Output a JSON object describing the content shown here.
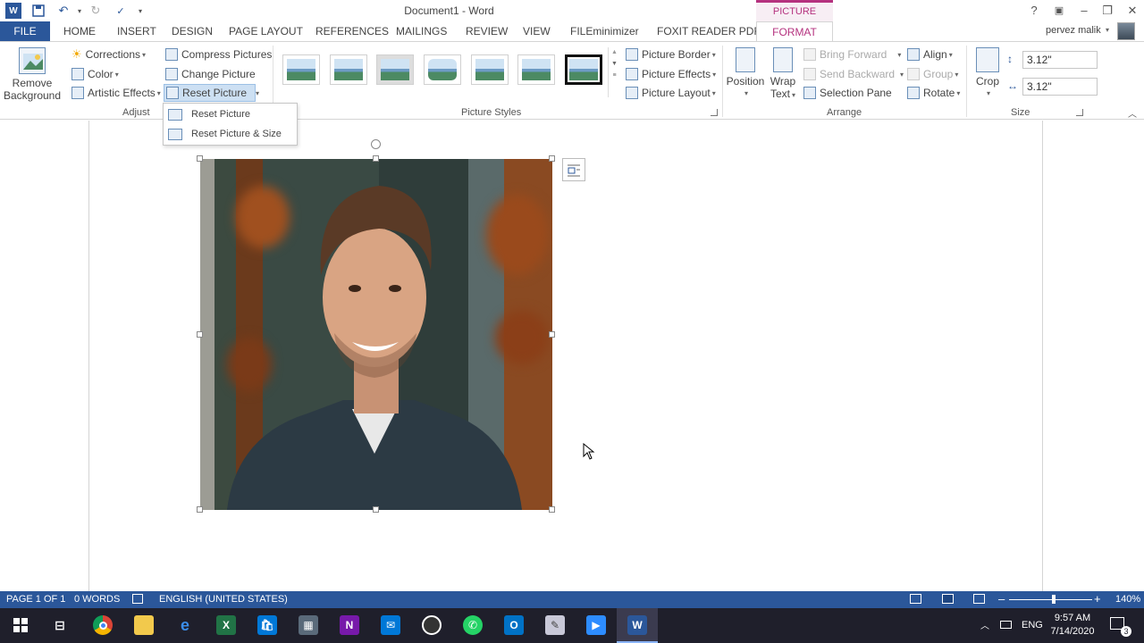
{
  "title_bar": {
    "document_title": "Document1 - Word",
    "contextual_tab_group": "PICTURE TOOLS",
    "help_label": "?",
    "minimize_label": "–",
    "restore_label": "❐",
    "close_label": "✕"
  },
  "tabs": {
    "file": "FILE",
    "items": [
      "HOME",
      "INSERT",
      "DESIGN",
      "PAGE LAYOUT",
      "REFERENCES",
      "MAILINGS",
      "REVIEW",
      "VIEW",
      "FILEminimizer",
      "FOXIT READER PDF"
    ],
    "format": "FORMAT",
    "user": "pervez malik"
  },
  "ribbon": {
    "remove_background": {
      "line1": "Remove",
      "line2": "Background"
    },
    "adjust": {
      "corrections": "Corrections",
      "color": "Color",
      "artistic_effects": "Artistic Effects",
      "compress_pictures": "Compress Pictures",
      "change_picture": "Change Picture",
      "reset_picture": "Reset Picture",
      "label": "Adjust"
    },
    "picture_styles": {
      "label": "Picture Styles",
      "picture_border": "Picture Border",
      "picture_effects": "Picture Effects",
      "picture_layout": "Picture Layout"
    },
    "arrange": {
      "label": "Arrange",
      "position": "Position",
      "wrap_text_1": "Wrap",
      "wrap_text_2": "Text",
      "bring_forward": "Bring Forward",
      "send_backward": "Send Backward",
      "selection_pane": "Selection Pane",
      "align": "Align",
      "group": "Group",
      "rotate": "Rotate"
    },
    "size": {
      "label": "Size",
      "crop": "Crop",
      "height": "3.12\"",
      "width": "3.12\""
    }
  },
  "dropdown": {
    "items": [
      "Reset Picture",
      "Reset Picture & Size"
    ]
  },
  "status_bar": {
    "page": "PAGE 1 OF 1",
    "words": "0 WORDS",
    "language": "ENGLISH (UNITED STATES)",
    "zoom": "140%",
    "zoom_minus": "–",
    "zoom_plus": "+"
  },
  "taskbar": {
    "language": "ENG",
    "time": "9:57 AM",
    "date": "7/14/2020",
    "notifications": "3"
  },
  "colors": {
    "accent": "#2b579a",
    "picture_tools": "#b5327f"
  }
}
